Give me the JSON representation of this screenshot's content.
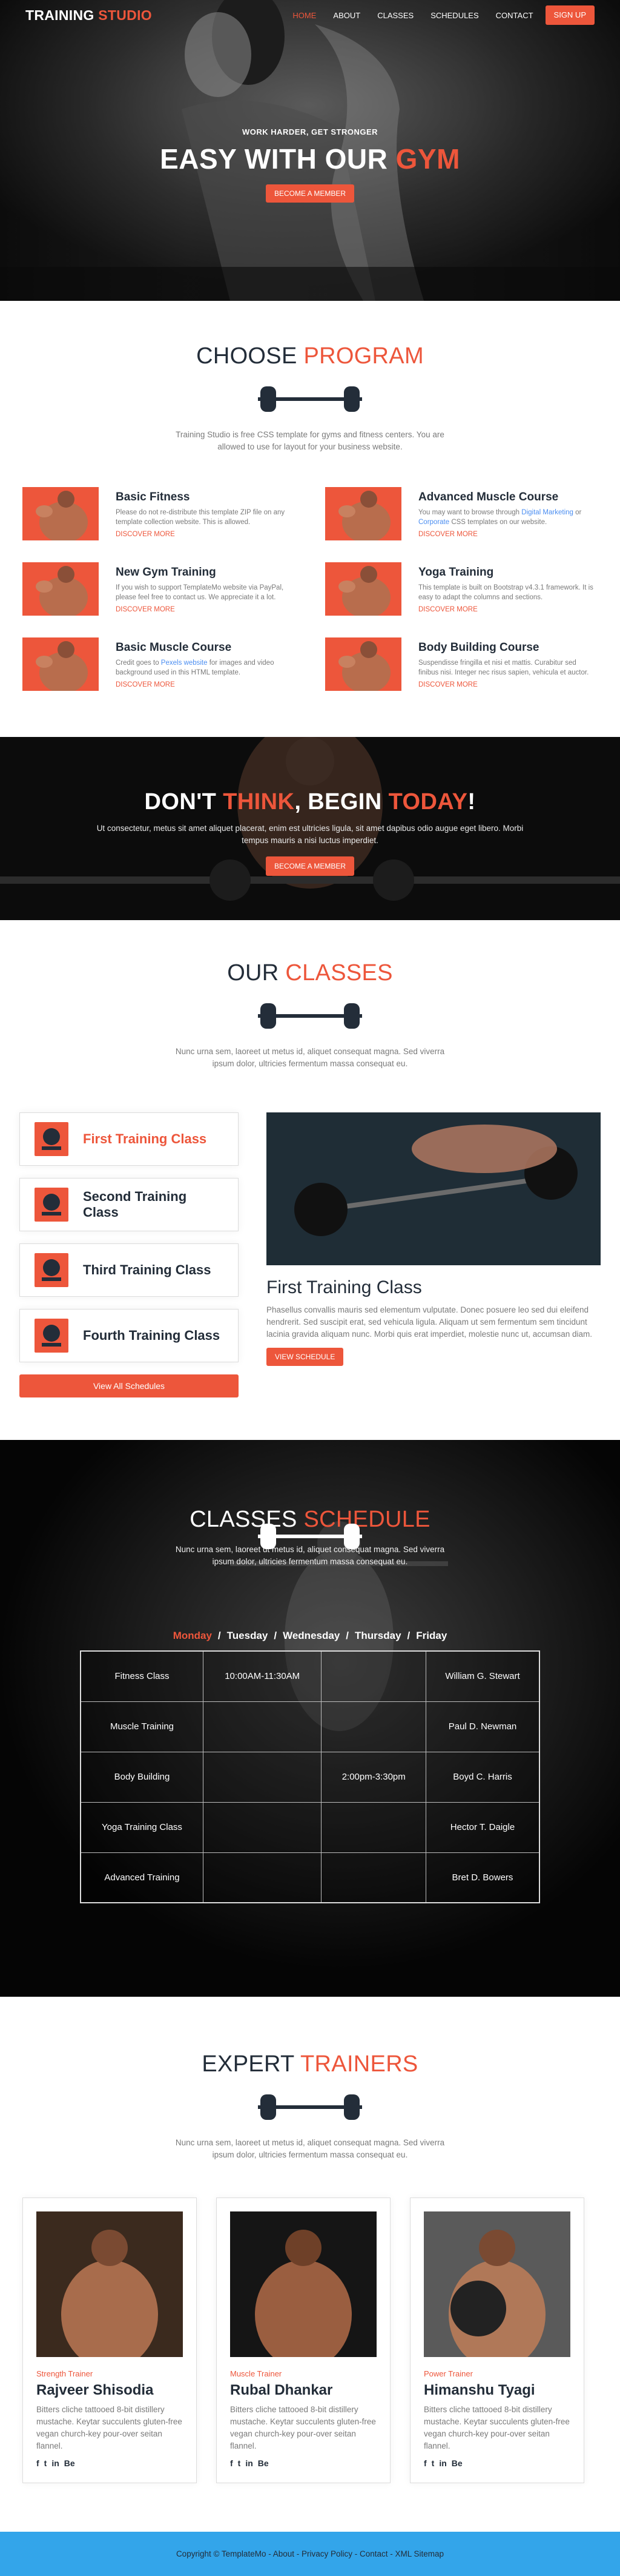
{
  "header": {
    "logo_main": "TRAINING",
    "logo_accent": "STUDIO",
    "nav": [
      "HOME",
      "ABOUT",
      "CLASSES",
      "SCHEDULES",
      "CONTACT"
    ],
    "signup": "SIGN UP"
  },
  "hero": {
    "kicker": "WORK HARDER, GET STRONGER",
    "title_main": "EASY WITH OUR",
    "title_accent": "GYM",
    "button": "BECOME A MEMBER"
  },
  "programs": {
    "title_main": "CHOOSE",
    "title_accent": "PROGRAM",
    "intro": "Training Studio is free CSS template for gyms and fitness centers. You are allowed to use for layout for your business website.",
    "items": [
      {
        "title": "Basic Fitness",
        "desc": "Please do not re-distribute this template ZIP file on any template collection website. This is allowed.",
        "link": "DISCOVER MORE"
      },
      {
        "title": "Advanced Muscle Course",
        "desc_a": "You may want to browse through ",
        "desc_link": "Digital Marketing",
        "desc_b": " or ",
        "desc_link2": "Corporate",
        "desc_c": " CSS templates on our website.",
        "link": "DISCOVER MORE"
      },
      {
        "title": "New Gym Training",
        "desc": "If you wish to support TemplateMo website via PayPal, please feel free to contact us. We appreciate it a lot.",
        "link": "DISCOVER MORE"
      },
      {
        "title": "Yoga Training",
        "desc": "This template is built on Bootstrap v4.3.1 framework. It is easy to adapt the columns and sections.",
        "link": "DISCOVER MORE"
      },
      {
        "title": "Basic Muscle Course",
        "desc_a": "Credit goes to ",
        "desc_link": "Pexels website",
        "desc_b": " for images and video background used in this HTML template.",
        "link": "DISCOVER MORE"
      },
      {
        "title": "Body Building Course",
        "desc": "Suspendisse fringilla et nisi et mattis. Curabitur sed finibus nisi. Integer nec risus sapien, vehicula et auctor.",
        "link": "DISCOVER MORE"
      }
    ]
  },
  "cta": {
    "t1": "DON'T",
    "t2": "THINK",
    "t3": ", BEGIN",
    "t4": "TODAY",
    "t5": "!",
    "text": "Ut consectetur, metus sit amet aliquet placerat, enim est ultricies ligula, sit amet dapibus odio augue eget libero. Morbi tempus mauris a nisi luctus imperdiet.",
    "button": "BECOME A MEMBER"
  },
  "classes": {
    "title_main": "OUR",
    "title_accent": "CLASSES",
    "intro": "Nunc urna sem, laoreet ut metus id, aliquet consequat magna. Sed viverra ipsum dolor, ultricies fermentum massa consequat eu.",
    "items": [
      "First Training Class",
      "Second Training Class",
      "Third Training Class",
      "Fourth Training Class"
    ],
    "view_all": "View All Schedules",
    "detail_title": "First Training Class",
    "detail_text": "Phasellus convallis mauris sed elementum vulputate. Donec posuere leo sed dui eleifend hendrerit. Sed suscipit erat, sed vehicula ligula. Aliquam ut sem fermentum sem tincidunt lacinia gravida aliquam nunc. Morbi quis erat imperdiet, molestie nunc ut, accumsan diam.",
    "detail_button": "VIEW SCHEDULE"
  },
  "schedule": {
    "title_main": "CLASSES",
    "title_accent": "SCHEDULE",
    "intro": "Nunc urna sem, laoreet ut metus id, aliquet consequat magna. Sed viverra ipsum dolor, ultricies fermentum massa consequat eu.",
    "days": [
      "Monday",
      "Tuesday",
      "Wednesday",
      "Thursday",
      "Friday"
    ],
    "rows": [
      [
        "Fitness Class",
        "10:00AM-11:30AM",
        "",
        "William G. Stewart"
      ],
      [
        "Muscle Training",
        "",
        "",
        "Paul D. Newman"
      ],
      [
        "Body Building",
        "",
        "2:00pm-3:30pm",
        "Boyd C. Harris"
      ],
      [
        "Yoga Training Class",
        "",
        "",
        "Hector T. Daigle"
      ],
      [
        "Advanced Training",
        "",
        "",
        "Bret D. Bowers"
      ]
    ]
  },
  "trainers": {
    "title_main": "EXPERT",
    "title_accent": "TRAINERS",
    "intro": "Nunc urna sem, laoreet ut metus id, aliquet consequat magna. Sed viverra ipsum dolor, ultricies fermentum massa consequat eu.",
    "items": [
      {
        "role": "Strength Trainer",
        "name": "Rajveer Shisodia",
        "text": "Bitters cliche tattooed 8-bit distillery mustache. Keytar succulents gluten-free vegan church-key pour-over seitan flannel."
      },
      {
        "role": "Muscle Trainer",
        "name": "Rubal Dhankar",
        "text": "Bitters cliche tattooed 8-bit distillery mustache. Keytar succulents gluten-free vegan church-key pour-over seitan flannel."
      },
      {
        "role": "Power Trainer",
        "name": "Himanshu Tyagi",
        "text": "Bitters cliche tattooed 8-bit distillery mustache. Keytar succulents gluten-free vegan church-key pour-over seitan flannel."
      }
    ],
    "social": [
      "f",
      "t",
      "in",
      "Be"
    ]
  },
  "footer": {
    "text": "Copyright © TemplateMo - About - Privacy Policy - Contact - XML Sitemap"
  },
  "colors": {
    "accent": "#ed563b",
    "dark": "#232d39",
    "footer": "#33a5ea"
  }
}
